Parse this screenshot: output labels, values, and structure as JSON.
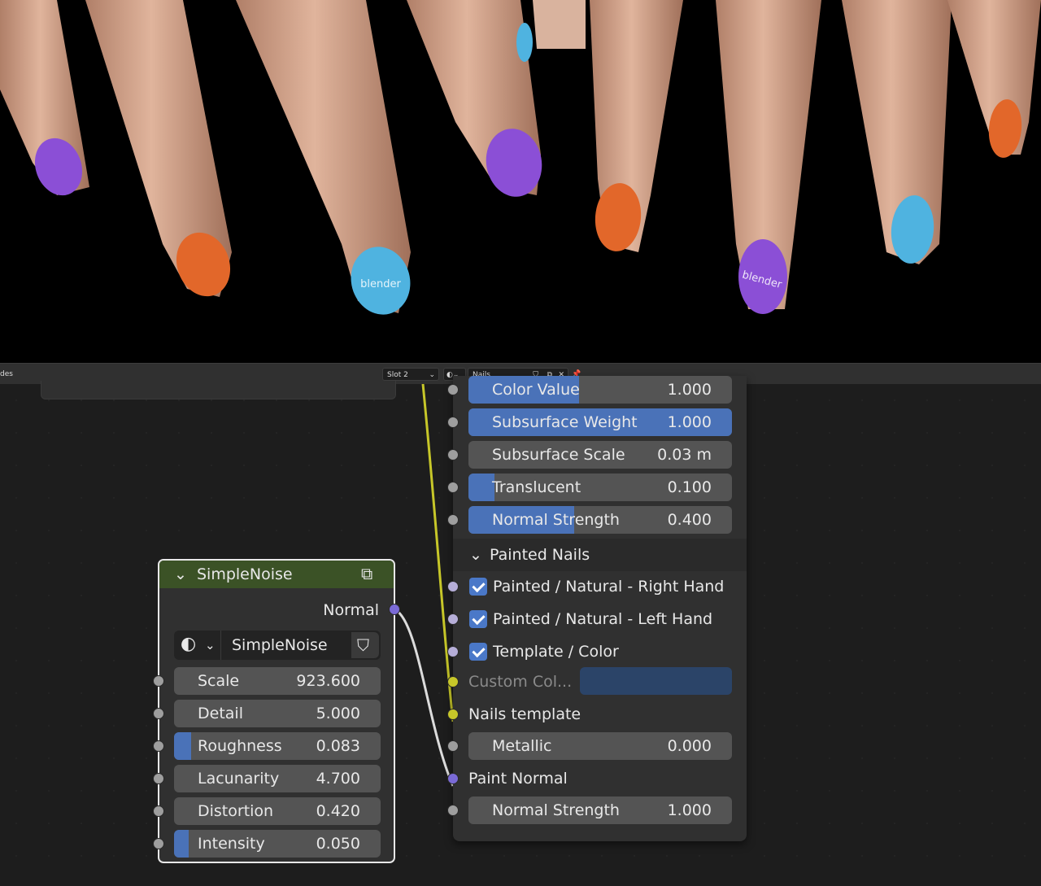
{
  "viewport": {
    "nails": [
      {
        "color": "#8b4fd6",
        "logo": ""
      },
      {
        "color": "#e2672a",
        "logo": ""
      },
      {
        "color": "#4fb3e0",
        "logo": "blender"
      },
      {
        "color": "#8b4fd6",
        "logo": ""
      },
      {
        "color": "#4fb3e0",
        "logo": ""
      },
      {
        "color": "#e2672a",
        "logo": ""
      },
      {
        "color": "#8b4fd6",
        "logo": "blender"
      },
      {
        "color": "#4fb3e0",
        "logo": ""
      },
      {
        "color": "#e2672a",
        "logo": ""
      }
    ]
  },
  "header": {
    "left_label": "des",
    "slot": "Slot 2",
    "material_name": "Nails"
  },
  "group_node": {
    "fields": [
      {
        "label": "Color Value",
        "value": "1.000",
        "fill": 0.42
      },
      {
        "label": "Subsurface Weight",
        "value": "1.000",
        "fill": 1.0
      },
      {
        "label": "Subsurface Scale",
        "value": "0.03 m",
        "fill": 0
      },
      {
        "label": "Translucent",
        "value": "0.100",
        "fill": 0.1
      },
      {
        "label": "Normal Strength",
        "value": "0.400",
        "fill": 0.4
      }
    ],
    "panel_title": "Painted Nails",
    "checks": [
      {
        "label": "Painted / Natural  -  Right Hand",
        "checked": true
      },
      {
        "label": "Painted / Natural  -  Left Hand",
        "checked": true
      },
      {
        "label": "Template / Color",
        "checked": true
      }
    ],
    "custom_color_label": "Custom Col...",
    "custom_color": "#2b4468",
    "nails_template_label": "Nails template",
    "metallic": {
      "label": "Metallic",
      "value": "0.000"
    },
    "paint_normal_label": "Paint Normal",
    "normal_strength2": {
      "label": "Normal Strength",
      "value": "1.000"
    }
  },
  "noise_node": {
    "title": "SimpleNoise",
    "output_label": "Normal",
    "selector_name": "SimpleNoise",
    "fields": [
      {
        "label": "Scale",
        "value": "923.600",
        "fill": 0
      },
      {
        "label": "Detail",
        "value": "5.000",
        "fill": 0
      },
      {
        "label": "Roughness",
        "value": "0.083",
        "fill": 0.083
      },
      {
        "label": "Lacunarity",
        "value": "4.700",
        "fill": 0
      },
      {
        "label": "Distortion",
        "value": "0.420",
        "fill": 0
      },
      {
        "label": "Intensity",
        "value": "0.050",
        "fill": 0.05
      }
    ]
  },
  "colors": {
    "accent": "#4a72b8",
    "noise_header": "#3b5226",
    "link_yellow": "#c7c729",
    "link_white": "#dcdcdc"
  }
}
